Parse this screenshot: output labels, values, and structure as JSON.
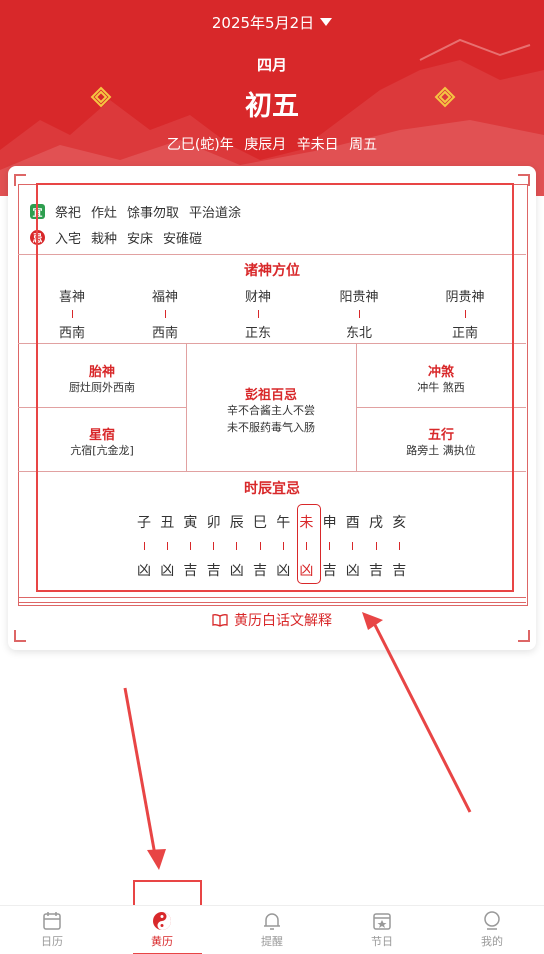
{
  "header": {
    "date": "2025年5月2日",
    "lunar_month": "四月",
    "lunar_day": "初五",
    "ganzhi": [
      "乙巳(蛇)年",
      "庚辰月",
      "辛未日",
      "周五"
    ]
  },
  "yi": {
    "label": "宜",
    "items": [
      "祭祀",
      "作灶",
      "馀事勿取",
      "平治道涂"
    ]
  },
  "ji": {
    "label": "忌",
    "items": [
      "入宅",
      "栽种",
      "安床",
      "安碓磑"
    ]
  },
  "zhushen": {
    "title": "诸神方位",
    "items": [
      {
        "name": "喜神",
        "dir": "西南"
      },
      {
        "name": "福神",
        "dir": "西南"
      },
      {
        "name": "财神",
        "dir": "正东"
      },
      {
        "name": "阳贵神",
        "dir": "东北"
      },
      {
        "name": "阴贵神",
        "dir": "正南"
      }
    ]
  },
  "taishen": {
    "title": "胎神",
    "text": "厨灶厕外西南"
  },
  "xingxiu": {
    "title": "星宿",
    "text": "亢宿[亢金龙]"
  },
  "pengzu": {
    "title": "彭祖百忌",
    "line1": "辛不合酱主人不尝",
    "line2": "未不服药毒气入肠"
  },
  "chongsha": {
    "title": "冲煞",
    "text": "冲牛 煞西"
  },
  "wuxing": {
    "title": "五行",
    "text": "路旁土 满执位"
  },
  "shichen": {
    "title": "时辰宜忌",
    "hours": [
      {
        "h": "子",
        "v": "凶"
      },
      {
        "h": "丑",
        "v": "凶"
      },
      {
        "h": "寅",
        "v": "吉"
      },
      {
        "h": "卯",
        "v": "吉"
      },
      {
        "h": "辰",
        "v": "凶"
      },
      {
        "h": "巳",
        "v": "吉"
      },
      {
        "h": "午",
        "v": "凶"
      },
      {
        "h": "未",
        "v": "凶"
      },
      {
        "h": "申",
        "v": "吉"
      },
      {
        "h": "酉",
        "v": "凶"
      },
      {
        "h": "戌",
        "v": "吉"
      },
      {
        "h": "亥",
        "v": "吉"
      }
    ],
    "current": "未"
  },
  "explain_label": "黄历白话文解释",
  "tabs": [
    {
      "label": "日历",
      "icon": "calendar-icon"
    },
    {
      "label": "黄历",
      "icon": "yinyang-icon"
    },
    {
      "label": "提醒",
      "icon": "bell-icon"
    },
    {
      "label": "节日",
      "icon": "festival-icon"
    },
    {
      "label": "我的",
      "icon": "profile-icon"
    }
  ],
  "colors": {
    "primary": "#d8282a",
    "annotation": "#e84545"
  }
}
